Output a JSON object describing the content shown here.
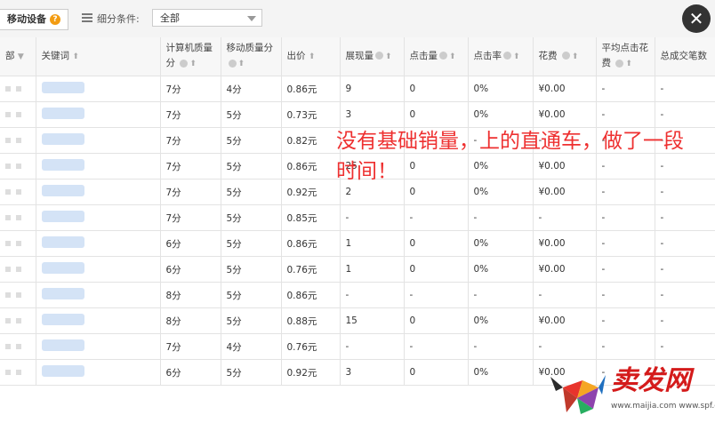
{
  "toolbar": {
    "device_label": "移动设备",
    "help_icon": "?",
    "filter_label": "细分条件:",
    "filter_value": "全部",
    "close_label": "✕"
  },
  "table": {
    "columns": [
      "部",
      "关键词",
      "计算机质量分",
      "移动质量分",
      "出价",
      "展现量",
      "点击量",
      "点击率",
      "花费",
      "平均点击花费",
      "总成交笔数"
    ],
    "rows": [
      {
        "pc": "7分",
        "mobile": "4分",
        "bid": "0.86元",
        "impr": "9",
        "clicks": "0",
        "ctr": "0%",
        "cost": "¥0.00",
        "cpc": "-",
        "deals": "-"
      },
      {
        "pc": "7分",
        "mobile": "5分",
        "bid": "0.73元",
        "impr": "3",
        "clicks": "0",
        "ctr": "0%",
        "cost": "¥0.00",
        "cpc": "-",
        "deals": "-"
      },
      {
        "pc": "7分",
        "mobile": "5分",
        "bid": "0.82元",
        "impr": "-",
        "clicks": "-",
        "ctr": "-",
        "cost": "-",
        "cpc": "-",
        "deals": "-"
      },
      {
        "pc": "7分",
        "mobile": "5分",
        "bid": "0.86元",
        "impr": "25",
        "clicks": "0",
        "ctr": "0%",
        "cost": "¥0.00",
        "cpc": "-",
        "deals": "-"
      },
      {
        "pc": "7分",
        "mobile": "5分",
        "bid": "0.92元",
        "impr": "2",
        "clicks": "0",
        "ctr": "0%",
        "cost": "¥0.00",
        "cpc": "-",
        "deals": "-"
      },
      {
        "pc": "7分",
        "mobile": "5分",
        "bid": "0.85元",
        "impr": "-",
        "clicks": "-",
        "ctr": "-",
        "cost": "-",
        "cpc": "-",
        "deals": "-"
      },
      {
        "pc": "6分",
        "mobile": "5分",
        "bid": "0.86元",
        "impr": "1",
        "clicks": "0",
        "ctr": "0%",
        "cost": "¥0.00",
        "cpc": "-",
        "deals": "-"
      },
      {
        "pc": "6分",
        "mobile": "5分",
        "bid": "0.76元",
        "impr": "1",
        "clicks": "0",
        "ctr": "0%",
        "cost": "¥0.00",
        "cpc": "-",
        "deals": "-"
      },
      {
        "pc": "8分",
        "mobile": "5分",
        "bid": "0.86元",
        "impr": "-",
        "clicks": "-",
        "ctr": "-",
        "cost": "-",
        "cpc": "-",
        "deals": "-"
      },
      {
        "pc": "8分",
        "mobile": "5分",
        "bid": "0.88元",
        "impr": "15",
        "clicks": "0",
        "ctr": "0%",
        "cost": "¥0.00",
        "cpc": "-",
        "deals": "-"
      },
      {
        "pc": "7分",
        "mobile": "4分",
        "bid": "0.76元",
        "impr": "-",
        "clicks": "-",
        "ctr": "-",
        "cost": "-",
        "cpc": "-",
        "deals": "-"
      },
      {
        "pc": "6分",
        "mobile": "5分",
        "bid": "0.92元",
        "impr": "3",
        "clicks": "0",
        "ctr": "0%",
        "cost": "¥0.00",
        "cpc": "-",
        "deals": "-"
      }
    ]
  },
  "overlay": {
    "text": "没有基础销量，上的直通车，做了一段时间！"
  },
  "watermark": {
    "brand": "卖发网",
    "url": "www.maijia.com  www.spf.cn/news"
  }
}
